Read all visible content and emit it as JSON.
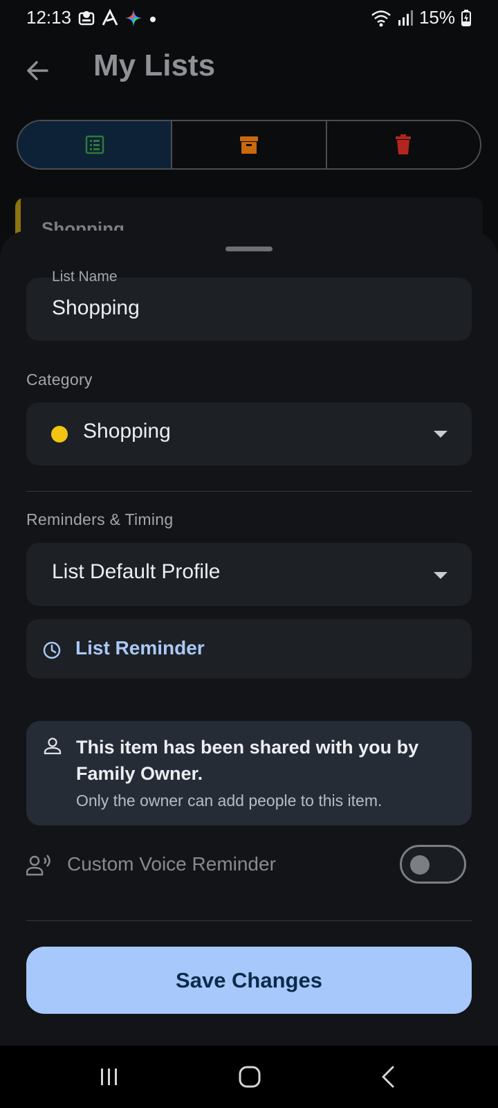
{
  "status_bar": {
    "time": "12:13",
    "battery": "15%"
  },
  "header": {
    "title": "My Lists"
  },
  "tabs": [
    {
      "icon": "list-icon",
      "color": "#2f7a3a",
      "active": true
    },
    {
      "icon": "archive-icon",
      "color": "#c9690e",
      "active": false
    },
    {
      "icon": "trash-icon",
      "color": "#b3261e",
      "active": false
    }
  ],
  "background_card": {
    "title": "Shopping",
    "accent_color": "#8c7410"
  },
  "sheet": {
    "list_name": {
      "label": "List Name",
      "value": "Shopping"
    },
    "category": {
      "section_label": "Category",
      "value": "Shopping",
      "dot_color": "#f2c511"
    },
    "reminders": {
      "section_label": "Reminders & Timing",
      "profile_value": "List Default Profile",
      "reminder_label": "List Reminder"
    },
    "shared_info": {
      "title": "This item has been shared with you by Family Owner.",
      "subtitle": "Only the owner can add people to this item."
    },
    "voice": {
      "label": "Custom Voice Reminder",
      "enabled": false
    },
    "save_label": "Save Changes"
  },
  "colors": {
    "accent": "#a7c8fb",
    "sheet_bg": "#121418",
    "field_bg": "#1d2025"
  }
}
